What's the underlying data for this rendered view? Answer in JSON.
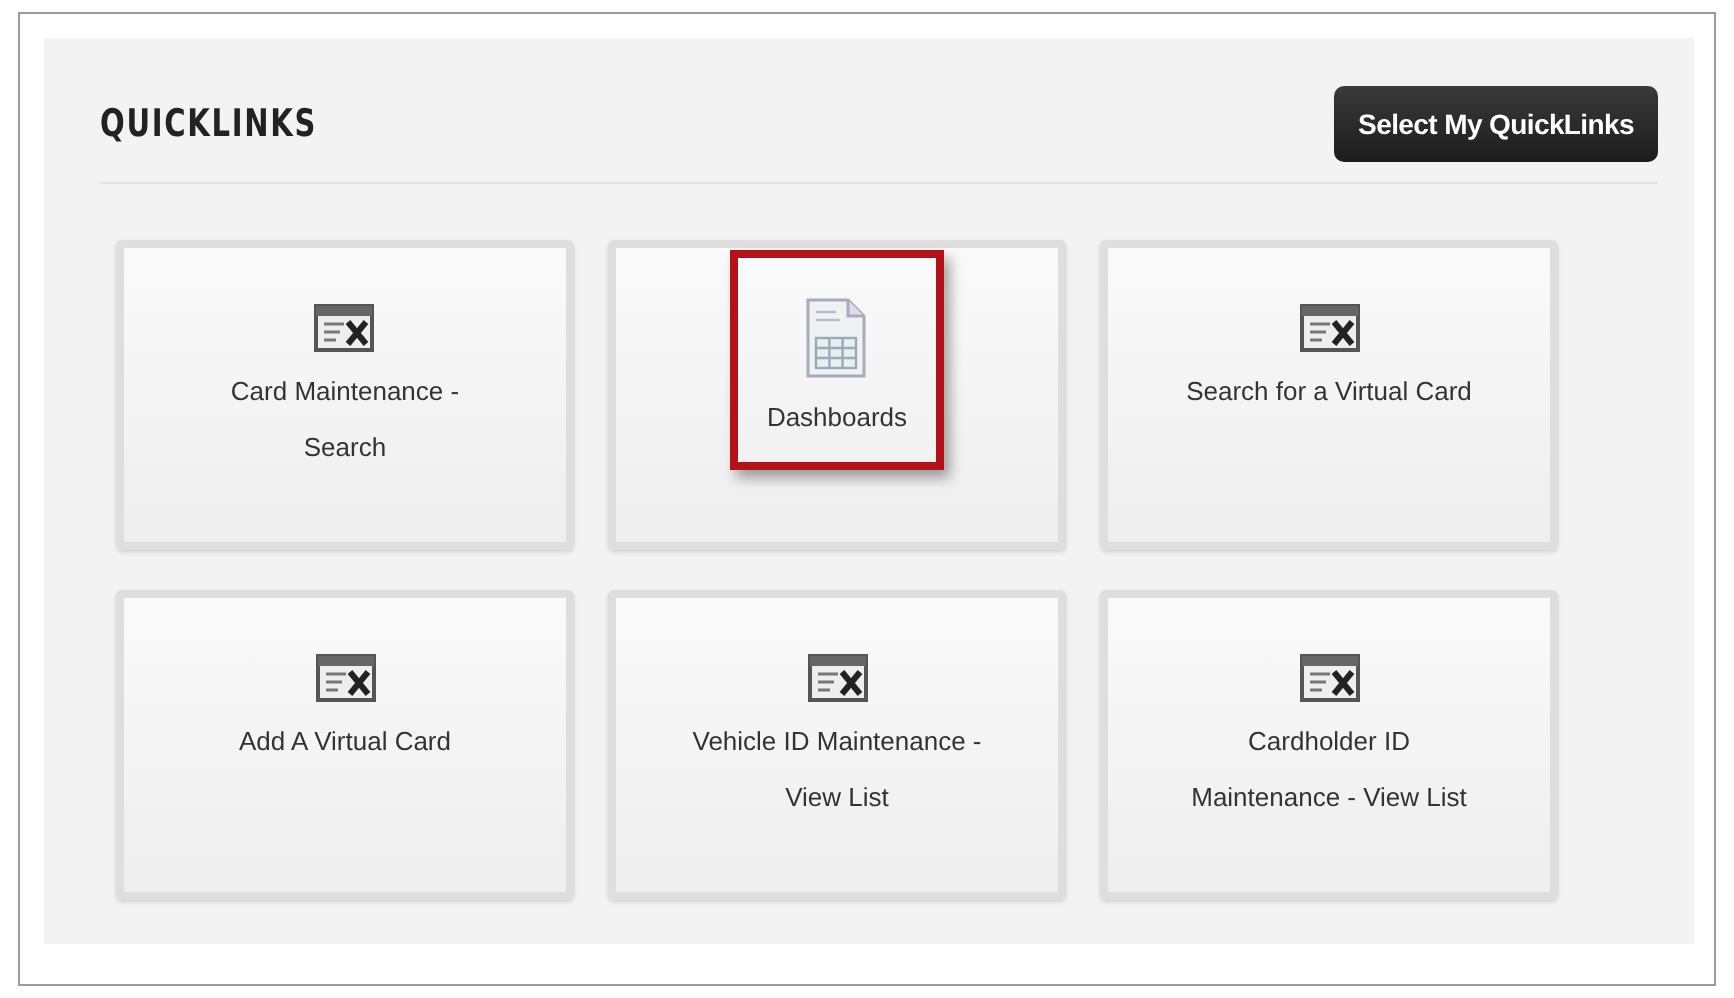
{
  "panel": {
    "title": "QUICKLINKS",
    "action_button": "Select My QuickLinks"
  },
  "tiles": [
    {
      "kind": "tools",
      "lines": [
        "Card Maintenance -",
        "Search"
      ],
      "highlighted": false
    },
    {
      "kind": "sheet",
      "lines": [
        "Dashboards"
      ],
      "highlighted": true
    },
    {
      "kind": "tools",
      "lines": [
        "Search for a Virtual Card"
      ],
      "highlighted": false
    },
    {
      "kind": "tools",
      "lines": [
        "Add A Virtual Card"
      ],
      "highlighted": false
    },
    {
      "kind": "tools",
      "lines": [
        "Vehicle ID Maintenance -",
        "View List"
      ],
      "highlighted": false
    },
    {
      "kind": "tools",
      "lines": [
        "Cardholder ID",
        "Maintenance - View List"
      ],
      "highlighted": false
    }
  ]
}
